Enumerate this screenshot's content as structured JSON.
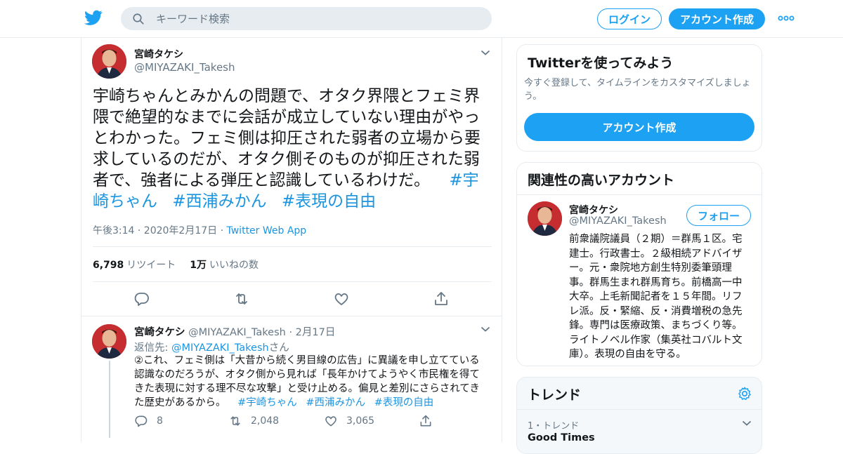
{
  "header": {
    "search_placeholder": "キーワード検索",
    "login_label": "ログイン",
    "signup_label": "アカウント作成"
  },
  "tweet": {
    "author_name": "宮崎タケシ",
    "author_handle": "@MIYAZAKI_Takesh",
    "text_main": "宇崎ちゃんとみかんの問題で、オタク界隈とフェミ界隈で絶望的なまでに会話が成立していない理由がやっとわかった。フェミ側は抑圧された弱者の立場から要求しているのだが、オタク側そのものが抑圧された弱者で、強者による弾圧と認識しているわけだ。",
    "hashtags": [
      "#宇崎ちゃん",
      "#西浦みかん",
      "#表現の自由"
    ],
    "timestamp": "午後3:14 · 2020年2月17日",
    "source": "Twitter Web App",
    "retweets_count": "6,798",
    "retweets_label": "リツイート",
    "likes_count": "1万",
    "likes_label": "いいねの数"
  },
  "reply": {
    "author_name": "宮崎タケシ",
    "author_handle": "@MIYAZAKI_Takesh",
    "date": "2月17日",
    "reply_to_prefix": "返信先: ",
    "reply_to_handle": "@MIYAZAKI_Takesh",
    "reply_to_suffix": "さん",
    "text": "②これ、フェミ側は「大昔から続く男目線の広告」に異議を申し立てている認識なのだろうが、オタク側から見れば「長年かけてようやく市民権を得てきた表現に対する理不尽な攻撃」と受け止める。偏見と差別にさらされてきた歴史があるから。",
    "hashtags": [
      "#宇崎ちゃん",
      "#西浦みかん",
      "#表現の自由"
    ],
    "reply_count": "8",
    "retweet_count": "2,048",
    "like_count": "3,065"
  },
  "signup_card": {
    "title": "Twitterを使ってみよう",
    "description": "今すぐ登録して、タイムラインをカスタマイズしましょう。",
    "button_label": "アカウント作成"
  },
  "related_card": {
    "title": "関連性の高いアカウント",
    "name": "宮崎タケシ",
    "handle": "@MIYAZAKI_Takesh",
    "follow_label": "フォロー",
    "bio": "前衆議院議員（２期）＝群馬１区。宅建士。行政書士。２級相続アドバイザー。元・衆院地方創生特別委筆頭理事。群馬生まれ群馬育ち。前橋高一中大卒。上毛新聞記者を１５年間。リフレ派。反・緊縮、反・消費増税の急先鋒。専門は医療政策、まちづくり等。ライトノベル作家（集英社コバルト文庫）。表現の自由を守る。"
  },
  "trends_card": {
    "title": "トレンド",
    "item_meta": "1・トレンド",
    "item_name": "Good Times"
  },
  "colors": {
    "accent": "#1da1f2",
    "link": "#1b95e0",
    "muted": "#657786",
    "border": "#e6ecf0"
  },
  "icons": [
    "twitter-bird-icon",
    "search-icon",
    "more-dots-icon",
    "chevron-down-icon",
    "reply-icon",
    "retweet-icon",
    "like-icon",
    "share-icon",
    "gear-icon"
  ]
}
